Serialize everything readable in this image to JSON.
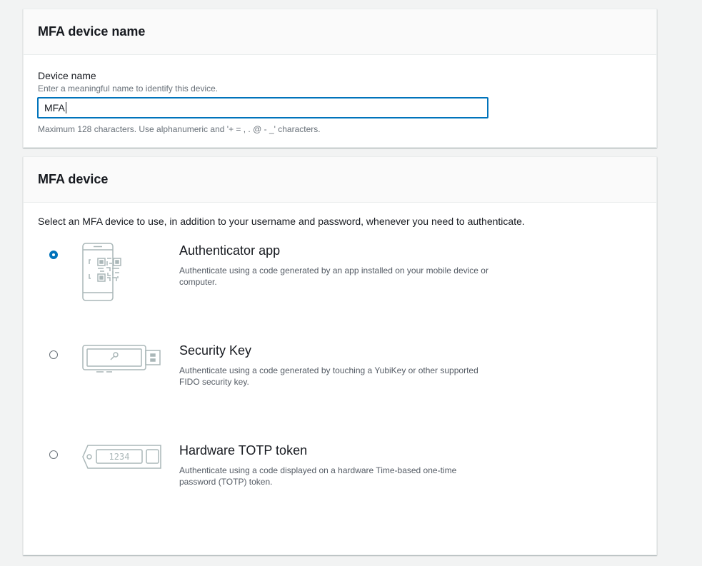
{
  "device_name_panel": {
    "title": "MFA device name",
    "field_label": "Device name",
    "field_description": "Enter a meaningful name to identify this device.",
    "field_value": "MFA",
    "field_constraint": "Maximum 128 characters. Use alphanumeric and '+ = , . @ - _' characters."
  },
  "device_panel": {
    "title": "MFA device",
    "intro": "Select an MFA device to use, in addition to your username and password, whenever you need to authenticate.",
    "options": [
      {
        "title": "Authenticator app",
        "description": "Authenticate using a code generated by an app installed on your mobile device or computer.",
        "icon": "phone-qr-icon",
        "selected": true
      },
      {
        "title": "Security Key",
        "description": "Authenticate using a code generated by touching a YubiKey or other supported FIDO security key.",
        "icon": "usb-key-icon",
        "selected": false
      },
      {
        "title": "Hardware TOTP token",
        "description": "Authenticate using a code displayed on a hardware Time-based one-time password (TOTP) token.",
        "icon": "totp-token-icon",
        "token_display": "1234",
        "selected": false
      }
    ]
  },
  "colors": {
    "accent": "#0073bb",
    "page_bg": "#f2f3f3",
    "panel_header_bg": "#fafafa",
    "icon_stroke": "#aab7b8"
  }
}
